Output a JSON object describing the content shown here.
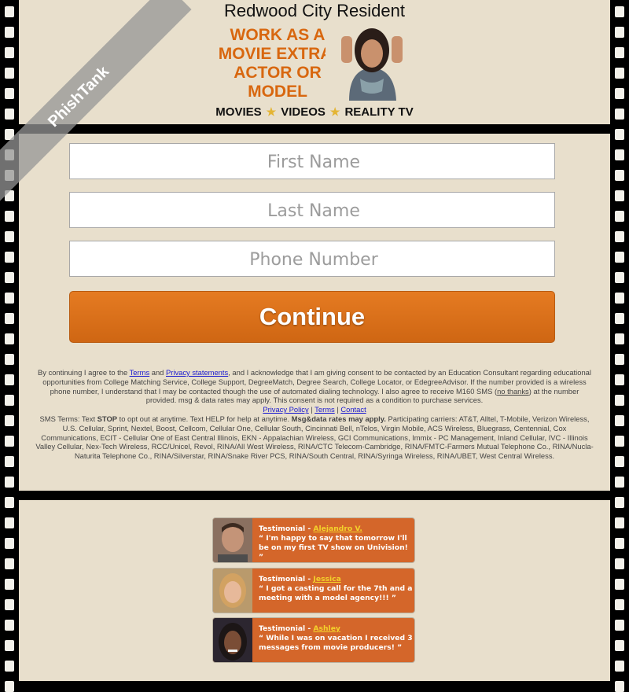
{
  "header": {
    "title": "Redwood City Resident",
    "promo_lines": [
      "WORK AS A",
      "MOVIE EXTRA,",
      "ACTOR OR",
      "MODEL"
    ],
    "tagline_items": [
      "MOVIES",
      "VIDEOS",
      "REALITY TV"
    ],
    "watermark": "PhishTank"
  },
  "form": {
    "first_name_placeholder": "First Name",
    "last_name_placeholder": "Last Name",
    "phone_placeholder": "Phone Number",
    "continue_label": "Continue"
  },
  "legal": {
    "p1_start": "By continuing I agree to the ",
    "terms_link": "Terms",
    "and": " and ",
    "privacy_statements_link": "Privacy statements",
    "p1_rest": ", and I acknowledge that I am giving consent to be contacted by an Education Consultant regarding educational opportunities from College Matching Service, College Support, DegreeMatch, Degree Search, College Locator, or EdegreeAdvisor. If the number provided is a wireless phone number, I understand that I may be contacted though the use of automated dialing technology. I also agree to receive M160 SMS (",
    "no_thanks": "no thanks",
    "p1_end": ") at the number provided. msg & data rates may apply. This consent is not required as a condition to purchase services.",
    "privacy_policy_link": "Privacy Policy",
    "terms_link2": "Terms",
    "contact_link": "Contact",
    "sep": " | ",
    "sms_start": "SMS Terms: Text ",
    "stop": "STOP",
    "sms_mid": " to opt out at anytime. Text HELP for help at anytime. ",
    "rates": "Msg&data rates may apply.",
    "carriers": " Participating carriers: AT&T, Alltel, T-Mobile, Verizon Wireless, U.S. Cellular, Sprint, Nextel, Boost, Cellcom, Cellular One, Cellular South, Cincinnati Bell, nTelos, Virgin Mobile, ACS Wireless, Bluegrass, Centennial, Cox Communications, ECIT - Cellular One of East Central Illinois, EKN - Appalachian Wireless, GCI Communications, Immix - PC Management, Inland Cellular, IVC - Illinois Valley Cellular, Nex-Tech Wireless, RCC/Unicel, Revol, RINA/All West Wireless, RINA/CTC Telecom-Cambridge, RINA/FMTC-Farmers Mutual Telephone Co., RINA/Nucla-Naturita Telephone Co., RINA/Silverstar, RINA/Snake River PCS, RINA/South Central, RINA/Syringa Wireless, RINA/UBET, West Central Wireless."
  },
  "testimonials": [
    {
      "label": "Testimonial - ",
      "name": "Alejandro V.",
      "quote": "“ I'm happy to say that tomorrow I'll be on my first TV show on Univision! ”"
    },
    {
      "label": "Testimonial - ",
      "name": "Jessica",
      "quote": "“ I got a casting call for the 7th and a meeting with a model agency!!! ”"
    },
    {
      "label": "Testimonial - ",
      "name": "Ashley",
      "quote": "“ While I was on vacation I received 3 messages from movie producers! ”"
    }
  ]
}
